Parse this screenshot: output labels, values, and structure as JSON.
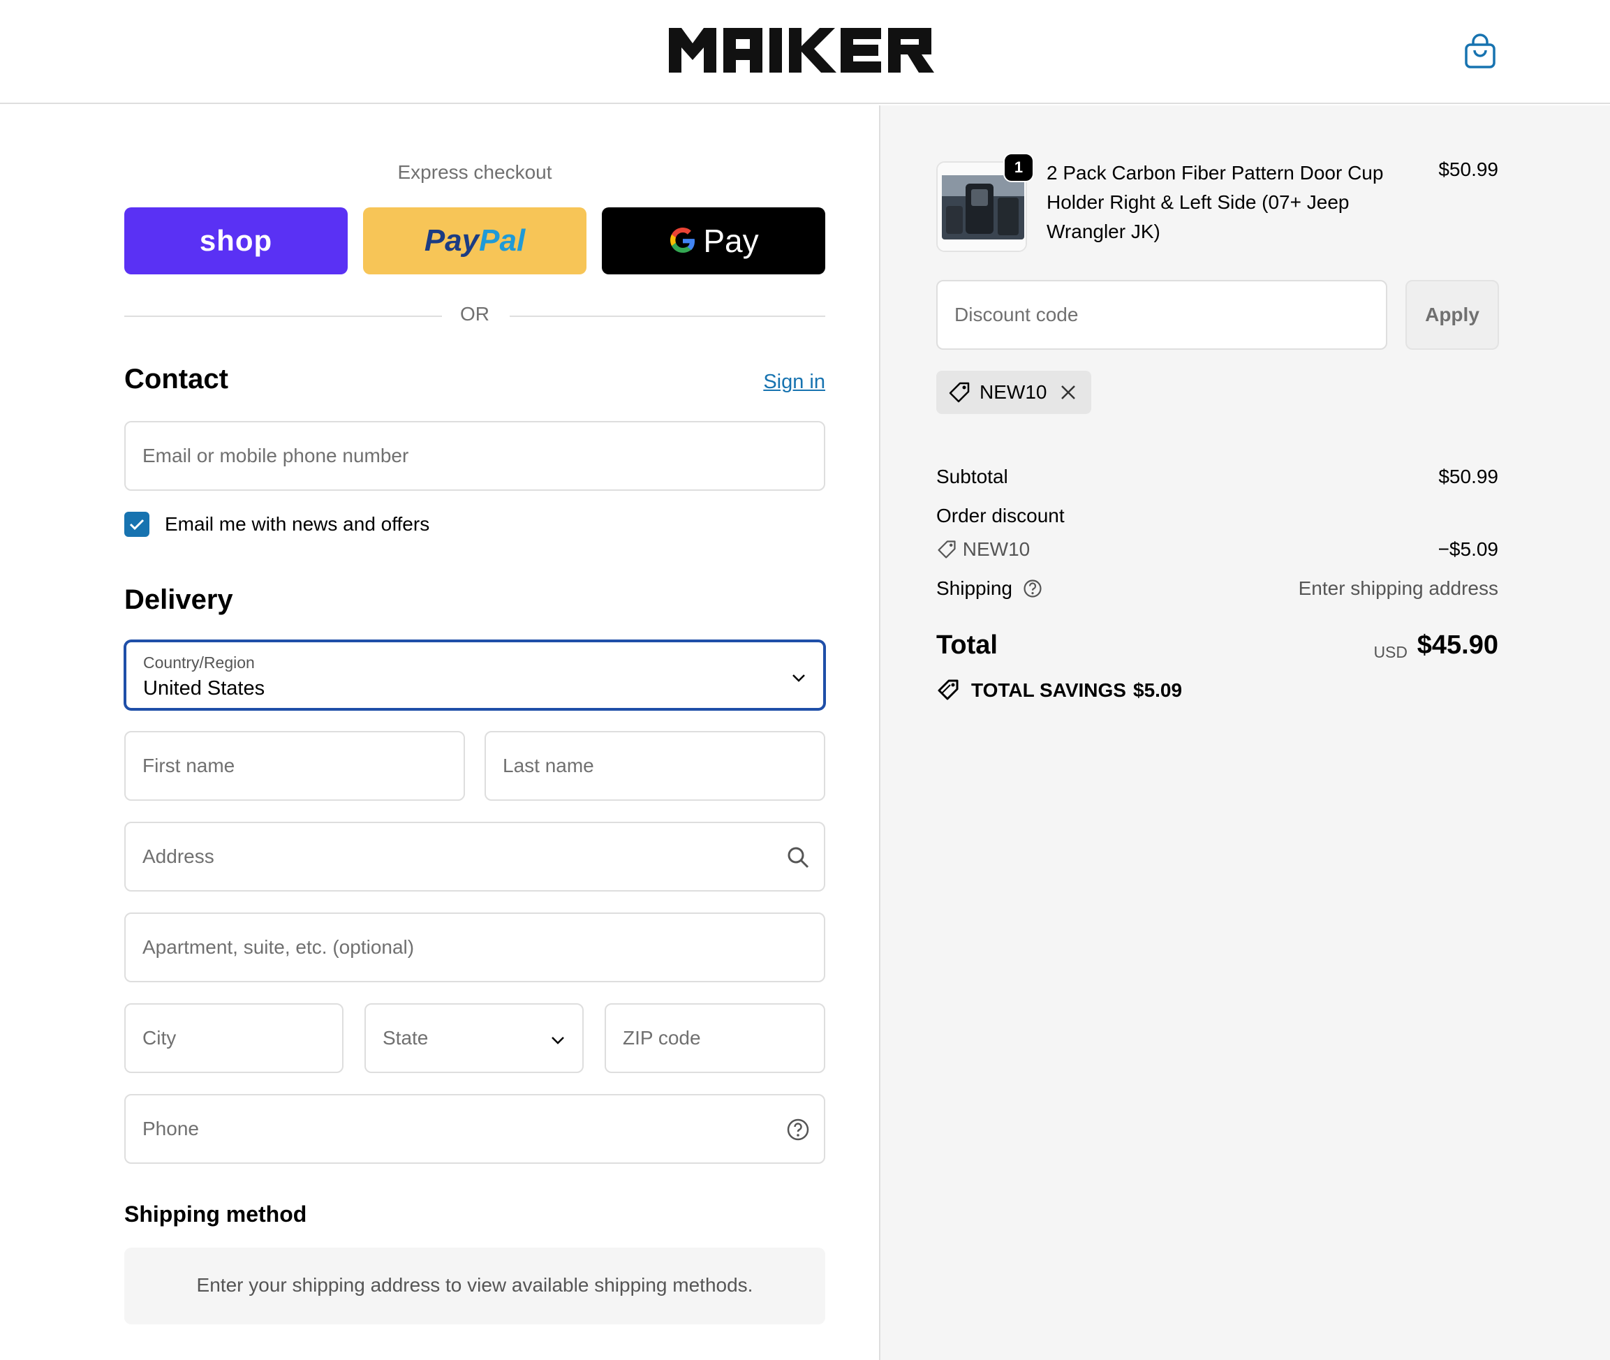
{
  "header": {
    "logo_text": "MAIKER",
    "cart_icon": "shopping-bag-icon"
  },
  "express": {
    "title": "Express checkout",
    "shop_label": "shop",
    "paypal_a": "Pay",
    "paypal_b": "Pal",
    "gpay_g": "G",
    "gpay_label": "Pay",
    "or_label": "OR"
  },
  "contact": {
    "title": "Contact",
    "sign_in": "Sign in",
    "email_placeholder": "Email or mobile phone number",
    "newsletter_label": "Email me with news and offers",
    "newsletter_checked": true
  },
  "delivery": {
    "title": "Delivery",
    "country_label": "Country/Region",
    "country_value": "United States",
    "first_name_placeholder": "First name",
    "last_name_placeholder": "Last name",
    "address_placeholder": "Address",
    "apartment_placeholder": "Apartment, suite, etc. (optional)",
    "city_placeholder": "City",
    "state_placeholder": "State",
    "zip_placeholder": "ZIP code",
    "phone_placeholder": "Phone"
  },
  "shipping_method": {
    "title": "Shipping method",
    "message": "Enter your shipping address to view available shipping methods."
  },
  "order": {
    "product": {
      "quantity": "1",
      "title": "2 Pack Carbon Fiber Pattern Door Cup Holder Right & Left Side (07+ Jeep Wrangler JK)",
      "price": "$50.99"
    },
    "discount_placeholder": "Discount code",
    "apply_label": "Apply",
    "applied_code": "NEW10",
    "subtotal_label": "Subtotal",
    "subtotal_value": "$50.99",
    "order_discount_label": "Order discount",
    "discount_code": "NEW10",
    "discount_value": "−$5.09",
    "shipping_label": "Shipping",
    "shipping_value": "Enter shipping address",
    "total_label": "Total",
    "currency": "USD",
    "total_value": "$45.90",
    "savings_label": "TOTAL SAVINGS",
    "savings_value": "$5.09"
  },
  "colors": {
    "accent": "#1773b0",
    "shop_purple": "#5a31f4",
    "paypal_yellow": "#f7c557",
    "focus_border": "#1f4fa8"
  }
}
